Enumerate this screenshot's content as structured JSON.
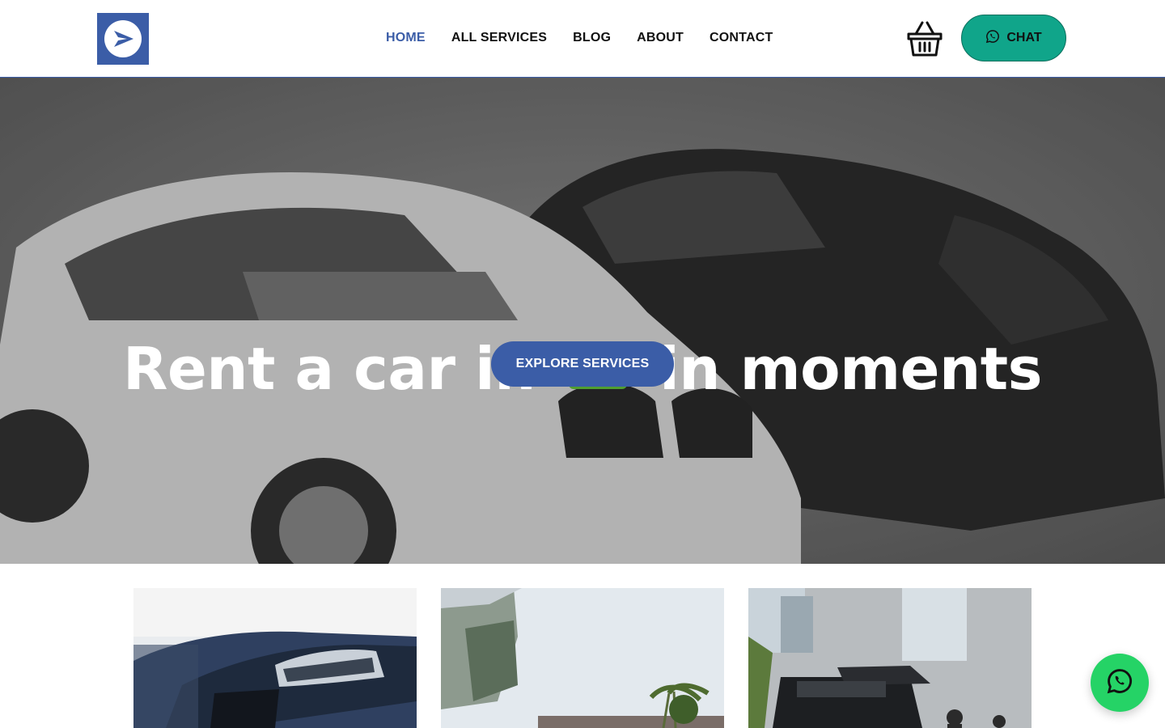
{
  "header": {
    "logo_icon": "play-arrow-logo",
    "nav": [
      {
        "label": "HOME",
        "active": true
      },
      {
        "label": "ALL SERVICES",
        "active": false
      },
      {
        "label": "BLOG",
        "active": false
      },
      {
        "label": "ABOUT",
        "active": false
      },
      {
        "label": "CONTACT",
        "active": false
      }
    ],
    "cart_icon": "shopping-basket-icon",
    "chat_label": "CHAT",
    "chat_icon": "whatsapp-icon"
  },
  "hero": {
    "title_before": "Rent a car in",
    "title_after": "in moments",
    "flag_icon": "azerbaijan-flag-icon",
    "cta_label": "EXPLORE SERVICES"
  },
  "cards": [
    {
      "image": "car-headlight-photo"
    },
    {
      "image": "glass-building-palm-trees-photo"
    },
    {
      "image": "suv-open-trunk-photo"
    }
  ],
  "colors": {
    "brand_blue": "#3b5da7",
    "chat_green": "#10a58a",
    "whatsapp_green": "#25d366"
  }
}
